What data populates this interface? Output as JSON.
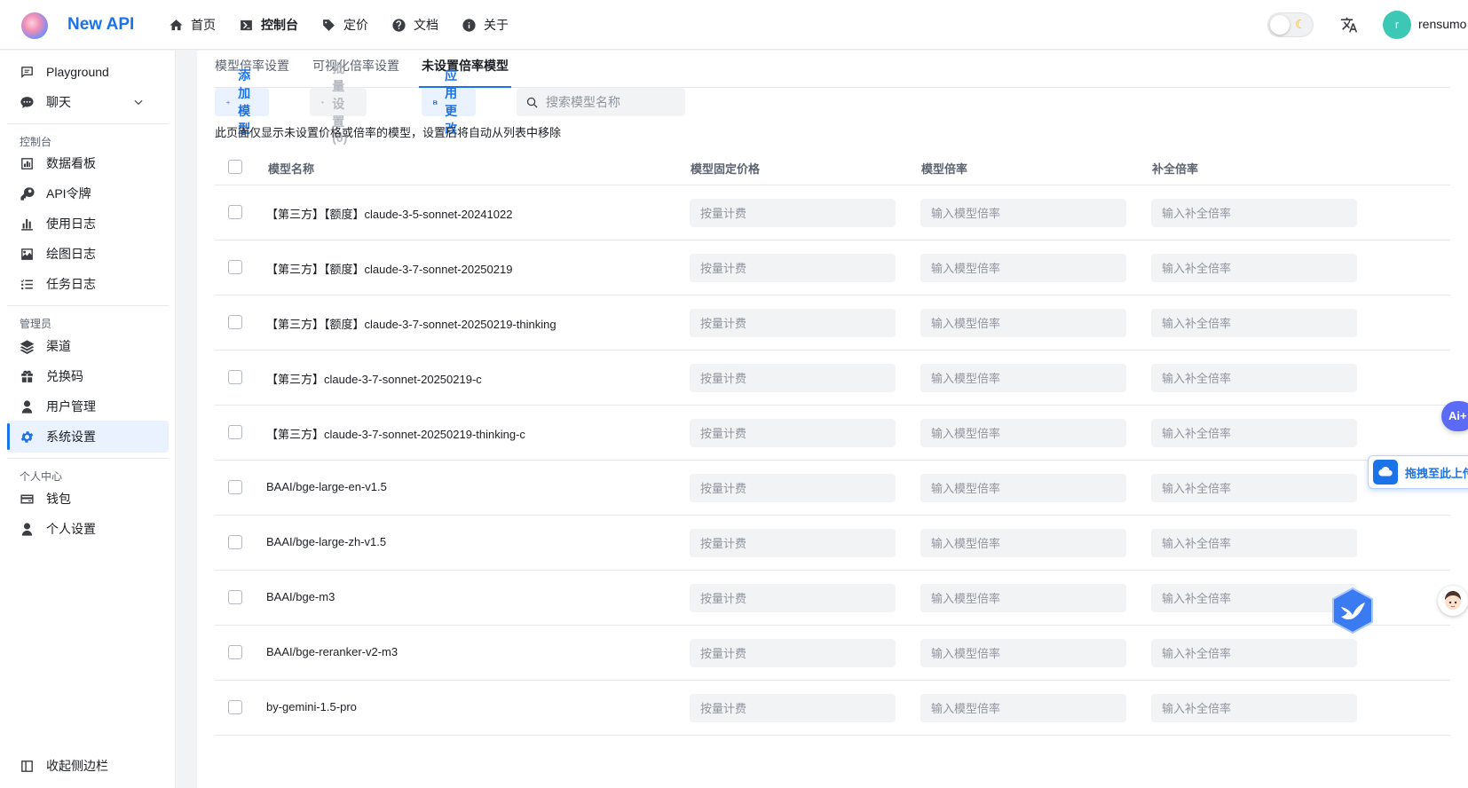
{
  "header": {
    "brand": "New API",
    "nav": [
      {
        "label": "首页",
        "icon": "home-icon"
      },
      {
        "label": "控制台",
        "icon": "terminal-icon",
        "active": true
      },
      {
        "label": "定价",
        "icon": "tag-icon"
      },
      {
        "label": "文档",
        "icon": "help-icon"
      },
      {
        "label": "关于",
        "icon": "info-icon"
      }
    ],
    "avatar_letter": "r",
    "username": "rensumo"
  },
  "sidebar": {
    "items": [
      {
        "label": "Playground",
        "icon": "chat-square-icon"
      },
      {
        "label": "聊天",
        "icon": "chat-bubble-icon"
      }
    ],
    "groups": {
      "console": "控制台",
      "admin": "管理员",
      "personal": "个人中心"
    },
    "console_items": [
      {
        "label": "数据看板",
        "icon": "dashboard-icon"
      },
      {
        "label": "API令牌",
        "icon": "key-icon"
      },
      {
        "label": "使用日志",
        "icon": "bar-chart-icon"
      },
      {
        "label": "绘图日志",
        "icon": "image-icon"
      },
      {
        "label": "任务日志",
        "icon": "task-list-icon"
      }
    ],
    "admin_items": [
      {
        "label": "渠道",
        "icon": "layers-icon"
      },
      {
        "label": "兑换码",
        "icon": "gift-icon"
      },
      {
        "label": "用户管理",
        "icon": "user-icon"
      },
      {
        "label": "系统设置",
        "icon": "gear-icon",
        "active": true
      }
    ],
    "personal_items": [
      {
        "label": "钱包",
        "icon": "wallet-icon"
      },
      {
        "label": "个人设置",
        "icon": "user-icon"
      }
    ],
    "collapse_label": "收起侧边栏"
  },
  "tabs": [
    {
      "label": "模型倍率设置"
    },
    {
      "label": "可视化倍率设置"
    },
    {
      "label": "未设置倍率模型",
      "active": true
    }
  ],
  "toolbar": {
    "add_label": "添加模型",
    "batch_label": "批量设置 (0)",
    "apply_label": "应用更改",
    "search_placeholder": "搜索模型名称"
  },
  "hint": "此页面仅显示未设置价格或倍率的模型，设置后将自动从列表中移除",
  "table": {
    "columns": [
      "模型名称",
      "模型固定价格",
      "模型倍率",
      "补全倍率"
    ],
    "placeholders": {
      "price": "按量计费",
      "ratio": "输入模型倍率",
      "completion": "输入补全倍率"
    },
    "rows": [
      {
        "name": "【第三方】【额度】claude-3-5-sonnet-20241022"
      },
      {
        "name": "【第三方】【额度】claude-3-7-sonnet-20250219"
      },
      {
        "name": "【第三方】【额度】claude-3-7-sonnet-20250219-thinking"
      },
      {
        "name": "【第三方】claude-3-7-sonnet-20250219-c"
      },
      {
        "name": "【第三方】claude-3-7-sonnet-20250219-thinking-c"
      },
      {
        "name": "BAAI/bge-large-en-v1.5"
      },
      {
        "name": "BAAI/bge-large-zh-v1.5"
      },
      {
        "name": "BAAI/bge-m3"
      },
      {
        "name": "BAAI/bge-reranker-v2-m3"
      },
      {
        "name": "by-gemini-1.5-pro"
      }
    ]
  },
  "floating": {
    "ai_label": "Ai+",
    "upload_label": "拖拽至此上传"
  },
  "colors": {
    "accent": "#1a73e8",
    "active_bg": "#eaf2ff",
    "avatar": "#3cc8b4"
  }
}
